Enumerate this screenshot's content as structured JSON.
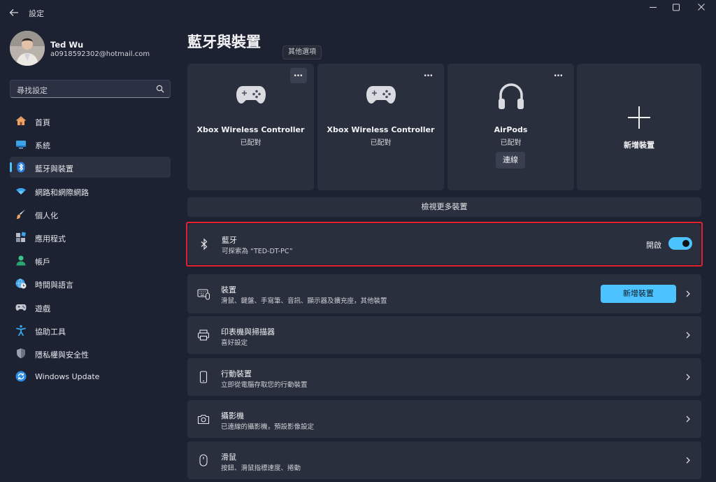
{
  "window": {
    "title": "設定"
  },
  "profile": {
    "name": "Ted Wu",
    "email": "a0918592302@hotmail.com"
  },
  "search": {
    "placeholder": "尋找設定"
  },
  "nav": {
    "items": [
      {
        "label": "首頁",
        "icon": "home-icon"
      },
      {
        "label": "系統",
        "icon": "monitor-icon"
      },
      {
        "label": "藍牙與裝置",
        "icon": "bluetooth-icon",
        "active": true
      },
      {
        "label": "網路和網際網路",
        "icon": "wifi-icon"
      },
      {
        "label": "個人化",
        "icon": "brush-icon"
      },
      {
        "label": "應用程式",
        "icon": "apps-icon"
      },
      {
        "label": "帳戶",
        "icon": "person-icon"
      },
      {
        "label": "時間與語言",
        "icon": "globe-clock-icon"
      },
      {
        "label": "遊戲",
        "icon": "gamepad-icon"
      },
      {
        "label": "協助工具",
        "icon": "accessibility-icon"
      },
      {
        "label": "隱私權與安全性",
        "icon": "shield-icon"
      },
      {
        "label": "Windows Update",
        "icon": "update-icon"
      }
    ]
  },
  "page": {
    "title": "藍牙與裝置"
  },
  "tooltip": {
    "text": "其他選項"
  },
  "devices": [
    {
      "name": "Xbox Wireless Controller",
      "status": "已配對",
      "icon": "gamepad-icon"
    },
    {
      "name": "Xbox Wireless Controller",
      "status": "已配對",
      "icon": "gamepad-icon"
    },
    {
      "name": "AirPods",
      "status": "已配對",
      "icon": "headphones-icon",
      "action": "連線"
    }
  ],
  "add_card": {
    "label": "新增裝置",
    "icon": "plus-icon"
  },
  "more_icon": "…",
  "view_more": "檢視更多裝置",
  "bluetooth": {
    "title": "藍牙",
    "subtitle": "可探索為 “TED-DT-PC”",
    "toggle_label": "開啟",
    "enabled": true
  },
  "rows": [
    {
      "title": "裝置",
      "subtitle": "滑鼠、鍵盤、手寫筆、音訊、顯示器及擴充座，其他裝置",
      "icon": "devices-icon",
      "button": "新增裝置"
    },
    {
      "title": "印表機與掃描器",
      "subtitle": "喜好設定",
      "icon": "printer-icon"
    },
    {
      "title": "行動裝置",
      "subtitle": "立即從電腦存取您的行動裝置",
      "icon": "phone-icon"
    },
    {
      "title": "攝影機",
      "subtitle": "已連線的攝影機，預設影像設定",
      "icon": "camera-icon"
    },
    {
      "title": "滑鼠",
      "subtitle": "按鈕、滑鼠指標速度、捲動",
      "icon": "mouse-icon"
    }
  ],
  "colors": {
    "accent": "#4cc2ff",
    "background": "#1d2233",
    "card": "#2a2f3e",
    "highlight": "#e0232e"
  }
}
